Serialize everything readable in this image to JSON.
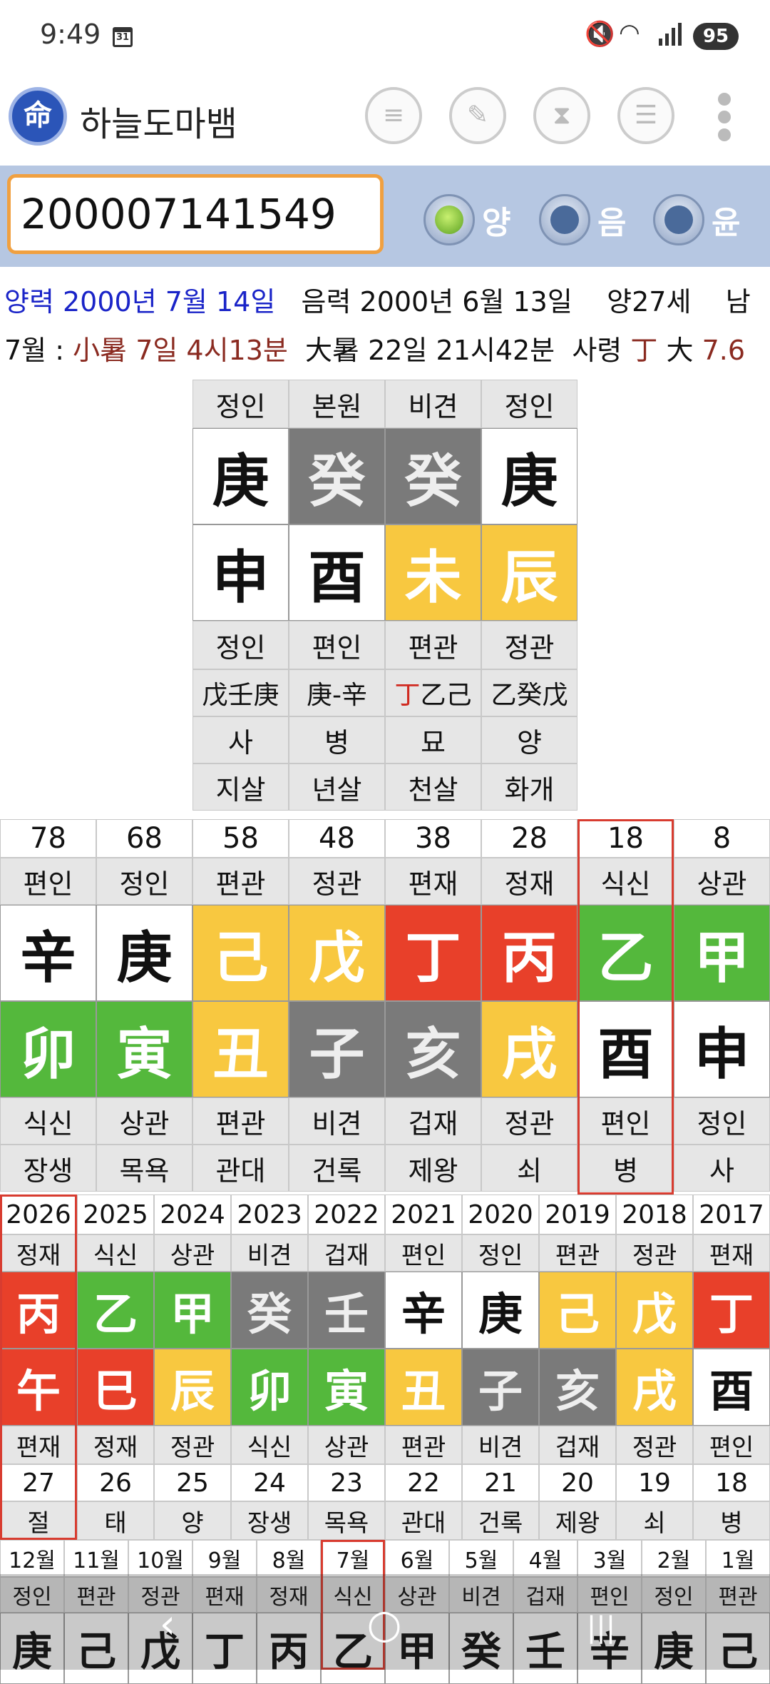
{
  "status": {
    "time": "9:49",
    "cal": "31",
    "battery": "95"
  },
  "app": {
    "title": "하늘도마뱀",
    "logo": "命"
  },
  "toolbar": {
    "icons": [
      "list-icon",
      "edit-icon",
      "hourglass-icon",
      "database-icon"
    ],
    "more": "more-vert-icon"
  },
  "input": {
    "value": "200007141549"
  },
  "radios": [
    {
      "label": "양",
      "on": true
    },
    {
      "label": "음",
      "on": false
    },
    {
      "label": "윤",
      "on": false
    }
  ],
  "info1": {
    "solar": "양력 2000년 7월 14일",
    "lunar": "음력 2000년 6월 13일",
    "age": "양27세",
    "sex": "남"
  },
  "info2": {
    "month": "7월 :",
    "jeol": "小暑 7일 4시13분",
    "jung": "大暑 22일 21시42분",
    "saryeong_label": "사령",
    "saryeong_val": "丁",
    "dae_label": "大",
    "dae_val": "7.6"
  },
  "colors": {
    "white": "#ffffff",
    "gray": "#7a7a7a",
    "yellow": "#f8c840",
    "red": "#e8402a",
    "green": "#54b83c",
    "accent": "#d83c30"
  },
  "pillars": {
    "top": [
      "정인",
      "본원",
      "비견",
      "정인"
    ],
    "stems": [
      {
        "t": "庚",
        "c": "w"
      },
      {
        "t": "癸",
        "c": "g"
      },
      {
        "t": "癸",
        "c": "g"
      },
      {
        "t": "庚",
        "c": "w"
      }
    ],
    "branches": [
      {
        "t": "申",
        "c": "w"
      },
      {
        "t": "酉",
        "c": "w"
      },
      {
        "t": "未",
        "c": "y"
      },
      {
        "t": "辰",
        "c": "y"
      }
    ],
    "gods": [
      "정인",
      "편인",
      "편관",
      "정관"
    ],
    "hidden": [
      "戊壬庚",
      "庚-辛",
      "丁乙己",
      "乙癸戊"
    ],
    "stages": [
      "사",
      "병",
      "묘",
      "양"
    ],
    "sal": [
      "지살",
      "년살",
      "천살",
      "화개"
    ]
  },
  "daeun": {
    "ages": [
      "78",
      "68",
      "58",
      "48",
      "38",
      "28",
      "18",
      "8"
    ],
    "top": [
      "편인",
      "정인",
      "편관",
      "정관",
      "편재",
      "정재",
      "식신",
      "상관"
    ],
    "stems": [
      {
        "t": "辛",
        "c": "w"
      },
      {
        "t": "庚",
        "c": "w"
      },
      {
        "t": "己",
        "c": "y"
      },
      {
        "t": "戊",
        "c": "y"
      },
      {
        "t": "丁",
        "c": "r"
      },
      {
        "t": "丙",
        "c": "r"
      },
      {
        "t": "乙",
        "c": "n"
      },
      {
        "t": "甲",
        "c": "n"
      }
    ],
    "branches": [
      {
        "t": "卯",
        "c": "n"
      },
      {
        "t": "寅",
        "c": "n"
      },
      {
        "t": "丑",
        "c": "y"
      },
      {
        "t": "子",
        "c": "g"
      },
      {
        "t": "亥",
        "c": "g"
      },
      {
        "t": "戌",
        "c": "y"
      },
      {
        "t": "酉",
        "c": "w"
      },
      {
        "t": "申",
        "c": "w"
      }
    ],
    "gods": [
      "식신",
      "상관",
      "편관",
      "비견",
      "겁재",
      "정관",
      "편인",
      "정인"
    ],
    "stages": [
      "장생",
      "목욕",
      "관대",
      "건록",
      "제왕",
      "쇠",
      "병",
      "사"
    ]
  },
  "seun": {
    "years": [
      "2026",
      "2025",
      "2024",
      "2023",
      "2022",
      "2021",
      "2020",
      "2019",
      "2018",
      "2017"
    ],
    "top": [
      "정재",
      "식신",
      "상관",
      "비견",
      "겁재",
      "편인",
      "정인",
      "편관",
      "정관",
      "편재"
    ],
    "stems": [
      {
        "t": "丙",
        "c": "r"
      },
      {
        "t": "乙",
        "c": "n"
      },
      {
        "t": "甲",
        "c": "n"
      },
      {
        "t": "癸",
        "c": "g"
      },
      {
        "t": "壬",
        "c": "g"
      },
      {
        "t": "辛",
        "c": "w"
      },
      {
        "t": "庚",
        "c": "w"
      },
      {
        "t": "己",
        "c": "y"
      },
      {
        "t": "戊",
        "c": "y"
      },
      {
        "t": "丁",
        "c": "r"
      }
    ],
    "branches": [
      {
        "t": "午",
        "c": "r"
      },
      {
        "t": "巳",
        "c": "r"
      },
      {
        "t": "辰",
        "c": "y"
      },
      {
        "t": "卯",
        "c": "n"
      },
      {
        "t": "寅",
        "c": "n"
      },
      {
        "t": "丑",
        "c": "y"
      },
      {
        "t": "子",
        "c": "g"
      },
      {
        "t": "亥",
        "c": "g"
      },
      {
        "t": "戌",
        "c": "y"
      },
      {
        "t": "酉",
        "c": "w"
      }
    ],
    "gods": [
      "편재",
      "정재",
      "정관",
      "식신",
      "상관",
      "편관",
      "비견",
      "겁재",
      "정관",
      "편인"
    ],
    "ages": [
      "27",
      "26",
      "25",
      "24",
      "23",
      "22",
      "21",
      "20",
      "19",
      "18"
    ],
    "stages": [
      "절",
      "태",
      "양",
      "장생",
      "목욕",
      "관대",
      "건록",
      "제왕",
      "쇠",
      "병"
    ]
  },
  "wolun": {
    "months": [
      "12월",
      "11월",
      "10월",
      "9월",
      "8월",
      "7월",
      "6월",
      "5월",
      "4월",
      "3월",
      "2월",
      "1월"
    ],
    "top": [
      "정인",
      "편관",
      "정관",
      "편재",
      "정재",
      "식신",
      "상관",
      "비견",
      "겁재",
      "편인",
      "정인",
      "편관"
    ],
    "stems": [
      {
        "t": "庚",
        "c": "w"
      },
      {
        "t": "己",
        "c": "w"
      },
      {
        "t": "戊",
        "c": "w"
      },
      {
        "t": "丁",
        "c": "w"
      },
      {
        "t": "丙",
        "c": "w"
      },
      {
        "t": "乙",
        "c": "w"
      },
      {
        "t": "甲",
        "c": "w"
      },
      {
        "t": "癸",
        "c": "w"
      },
      {
        "t": "壬",
        "c": "w"
      },
      {
        "t": "辛",
        "c": "w"
      },
      {
        "t": "庚",
        "c": "w"
      },
      {
        "t": "己",
        "c": "w"
      }
    ]
  },
  "nav": {
    "back": "‹",
    "home": "○",
    "recent": "|||"
  }
}
